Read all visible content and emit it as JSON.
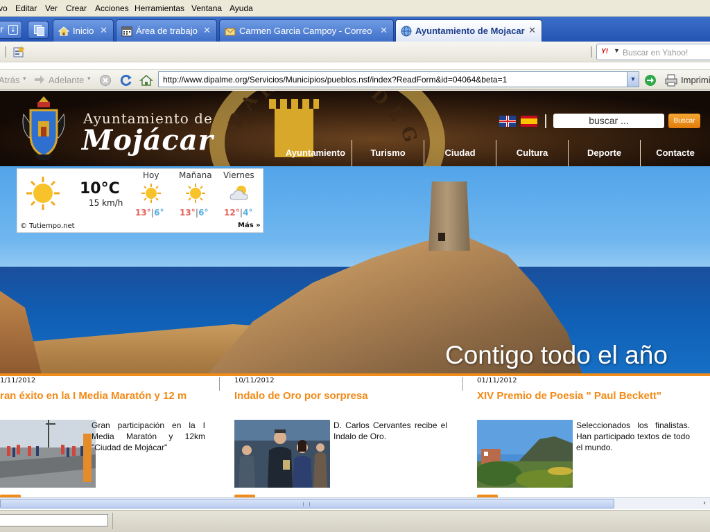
{
  "menu": [
    "vo",
    "Editar",
    "Ver",
    "Crear",
    "Acciones",
    "Herramientas",
    "Ventana",
    "Ayuda"
  ],
  "tabs": [
    {
      "label": "Inicio",
      "icon": "home-icon",
      "active": false
    },
    {
      "label": "Área de trabajo",
      "icon": "calendar-icon",
      "active": false
    },
    {
      "label": "Carmen Garcia Campoy - Correo",
      "icon": "mail-icon",
      "active": false
    },
    {
      "label": "Ayuntamiento de Mojacar",
      "icon": "globe-icon",
      "active": true
    }
  ],
  "tab_back_label": "r",
  "yahoo_search": {
    "placeholder": "Buscar en Yahoo!"
  },
  "nav": {
    "back": "Atrás",
    "forward": "Adelante",
    "print": "Imprimir"
  },
  "url": "http://www.dipalme.org/Servicios/Municipios/pueblos.nsf/index?ReadForm&id=04064&beta=1",
  "site": {
    "title_line1": "Ayuntamiento de",
    "title_line2": "Mojácar",
    "search_value": "buscar ...",
    "search_button": "Buscar",
    "nav_items": [
      "Ayuntamiento",
      "Turismo",
      "Ciudad",
      "Cultura",
      "Deporte",
      "Contacte"
    ],
    "hero_caption": "Contigo todo el año"
  },
  "weather": {
    "current_temp": "10°C",
    "wind": "15 km/h",
    "forecast": [
      {
        "day": "Hoy",
        "hi": "13°",
        "lo": "6°",
        "icon": "sun-icon"
      },
      {
        "day": "Mañana",
        "hi": "13°",
        "lo": "6°",
        "icon": "sun-icon"
      },
      {
        "day": "Viernes",
        "hi": "12°",
        "lo": "4°",
        "icon": "cloud-sun-icon"
      }
    ],
    "credit": "© Tutiempo.net",
    "more": "Más »"
  },
  "news": [
    {
      "date": "1/11/2012",
      "title": "ran éxito en la I Media Maratón y 12 m",
      "text": "Gran participación en la I Media Maratón y 12km \"Ciudad de Mojácar\""
    },
    {
      "date": "10/11/2012",
      "title": "Indalo de Oro por sorpresa",
      "text": "D. Carlos Cervantes recibe el Indalo de Oro."
    },
    {
      "date": "01/11/2012",
      "title": "XIV Premio de Poesia \" Paul Beckett\"",
      "text": "Seleccionados los finalistas. Han participado textos de todo el mundo."
    }
  ],
  "colors": {
    "accent": "#f08c1a",
    "tab_blue": "#2454b3",
    "header_dark": "#2a170a"
  }
}
